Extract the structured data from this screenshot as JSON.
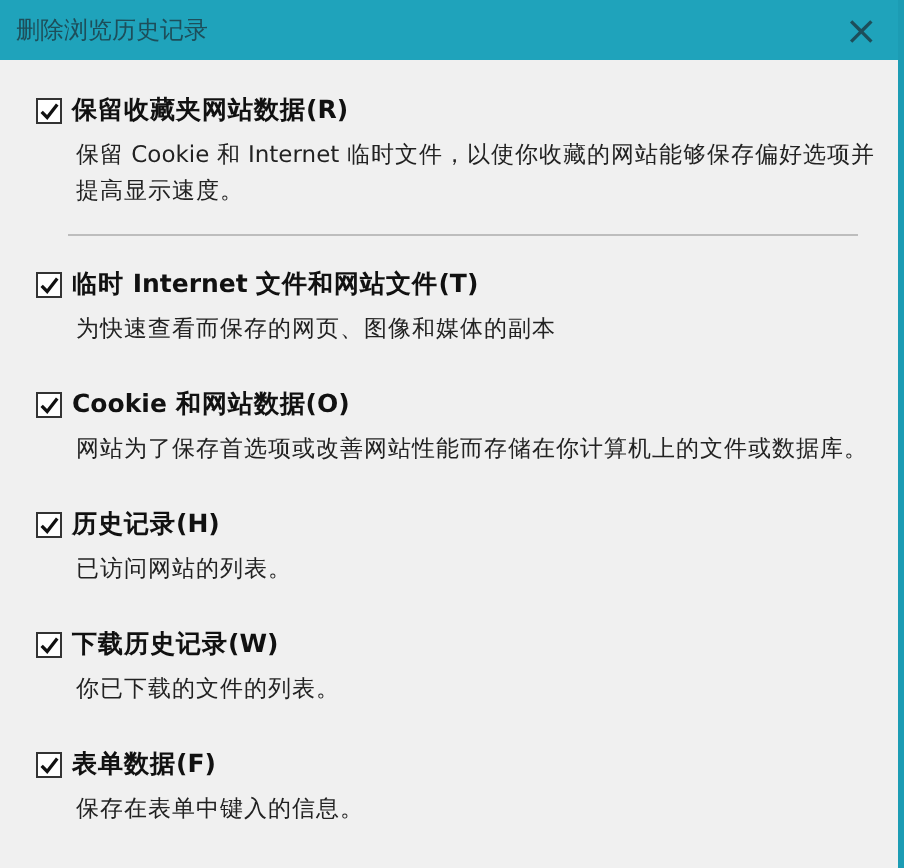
{
  "window": {
    "title": "删除浏览历史记录",
    "close": "×"
  },
  "options": [
    {
      "label": "保留收藏夹网站数据(R)",
      "checked": true,
      "description": "保留 Cookie 和 Internet 临时文件，以使你收藏的网站能够保存偏好选项并提高显示速度。",
      "divider_after": true
    },
    {
      "label": "临时 Internet 文件和网站文件(T)",
      "checked": true,
      "description": "为快速查看而保存的网页、图像和媒体的副本"
    },
    {
      "label": "Cookie 和网站数据(O)",
      "checked": true,
      "description": "网站为了保存首选项或改善网站性能而存储在你计算机上的文件或数据库。"
    },
    {
      "label": "历史记录(H)",
      "checked": true,
      "description": "已访问网站的列表。"
    },
    {
      "label": "下载历史记录(W)",
      "checked": true,
      "description": "你已下载的文件的列表。"
    },
    {
      "label": "表单数据(F)",
      "checked": true,
      "description": "保存在表单中键入的信息。"
    }
  ]
}
